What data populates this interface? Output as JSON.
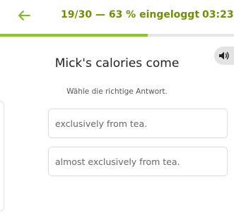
{
  "header": {
    "back_icon": "arrow-left-icon",
    "progress_text": "19/30 — 63 % eingeloggt",
    "timer": "03:23",
    "progress_fraction": 0.63,
    "accent_color": "#6d8f00",
    "progress_color": "#8ec71f"
  },
  "sound_button": {
    "icon": "speaker-icon"
  },
  "question": {
    "text": "Mick's calories come",
    "instruction": "Wähle die richtige Antwort."
  },
  "answers": [
    {
      "text": "exclusively from tea."
    },
    {
      "text": "almost exclusively from tea."
    }
  ]
}
